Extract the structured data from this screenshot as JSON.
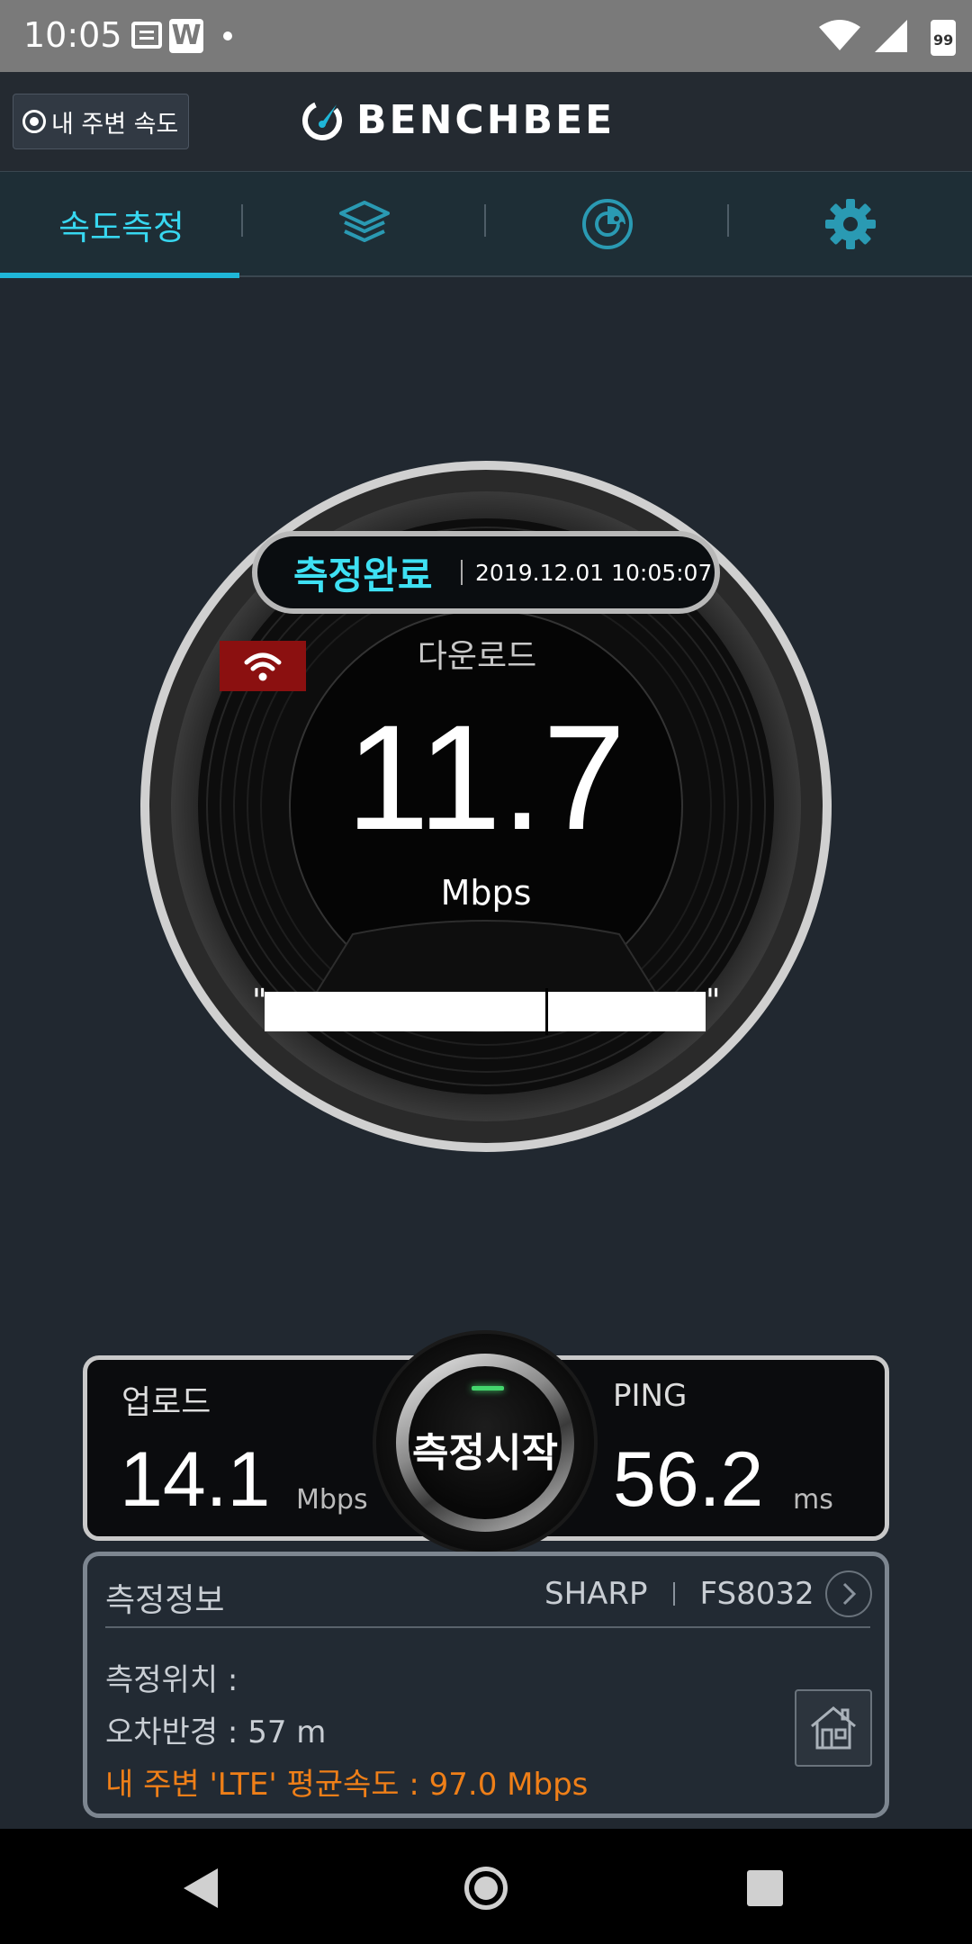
{
  "status_bar": {
    "time": "10:05",
    "app_icon": "W",
    "battery": "99",
    "icons": [
      "message-icon",
      "w-app-icon",
      "dot-icon",
      "wifi-icon",
      "signal-icon",
      "battery-icon"
    ]
  },
  "header": {
    "nearby_label": "내 주변 속도",
    "logo_text": "BENCHBEE"
  },
  "tabs": [
    {
      "label": "속도측정",
      "icon": null,
      "active": true
    },
    {
      "label": "",
      "icon": "layers-icon",
      "active": false
    },
    {
      "label": "",
      "icon": "chart-icon",
      "active": false
    },
    {
      "label": "",
      "icon": "gear-icon",
      "active": false
    }
  ],
  "gauge": {
    "status": "측정완료",
    "timestamp": "2019.12.01 10:05:07",
    "label": "다운로드",
    "value": "11.7",
    "unit": "Mbps",
    "connection_icon": "wifi-icon"
  },
  "stats": {
    "upload_label": "업로드",
    "upload_value": "14.1",
    "upload_unit": "Mbps",
    "ping_label": "PING",
    "ping_value": "56.2",
    "ping_unit": "ms",
    "start_label": "측정시작"
  },
  "info": {
    "title": "측정정보",
    "brand": "SHARP",
    "model": "FS8032",
    "location": "측정위치 :",
    "error_radius": "오차반경 : 57 m",
    "average": "내 주변 'LTE' 평균속도 :  97.0 Mbps"
  },
  "colors": {
    "accent": "#37d7f0",
    "background": "#212830",
    "highlight": "#ef7f18",
    "badge": "#8b1010"
  }
}
